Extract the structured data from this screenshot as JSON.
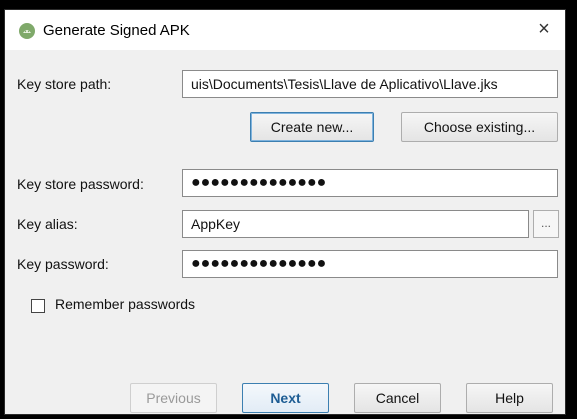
{
  "window": {
    "title": "Generate Signed APK",
    "close_glyph": "×"
  },
  "form": {
    "keystore_path_label": "Key store path:",
    "keystore_path_value": "uis\\Documents\\Tesis\\Llave de Aplicativo\\Llave.jks",
    "create_new_label": "Create new...",
    "choose_existing_label": "Choose existing...",
    "keystore_password_label": "Key store password:",
    "keystore_password_value": "●●●●●●●●●●●●●●",
    "key_alias_label": "Key alias:",
    "key_alias_value": "AppKey",
    "browse_label": "...",
    "key_password_label": "Key password:",
    "key_password_value": "●●●●●●●●●●●●●●",
    "remember_label": "Remember passwords"
  },
  "footer": {
    "previous_label": "Previous",
    "next_label": "Next",
    "cancel_label": "Cancel",
    "help_label": "Help"
  },
  "icons": {
    "app": "android-icon"
  },
  "colors": {
    "accent": "#3c7fb1",
    "next_text": "#1e5d94"
  }
}
